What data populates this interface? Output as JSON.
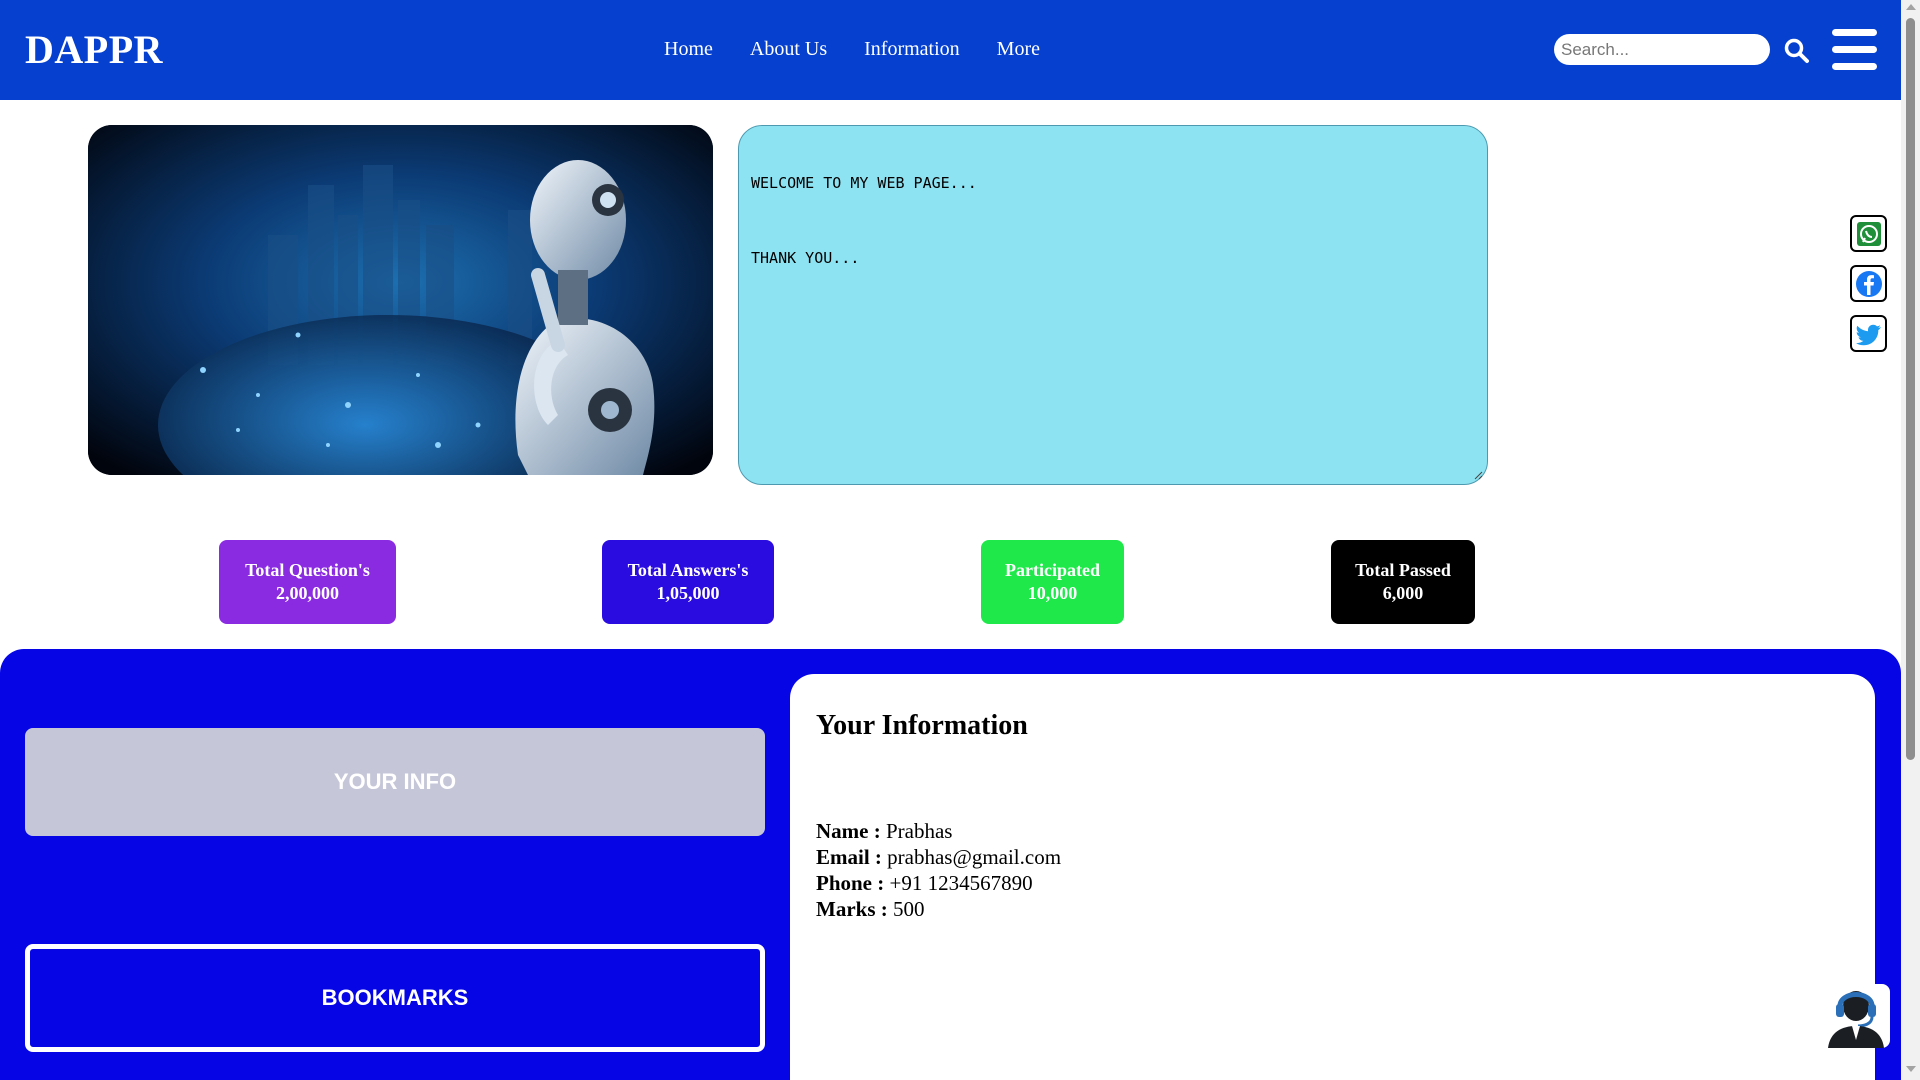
{
  "header": {
    "brand": "DAPPR",
    "nav": [
      "Home",
      "About Us",
      "Information",
      "More"
    ],
    "search_placeholder": "Search...",
    "background_color": "#0540cf"
  },
  "hero": {
    "image_description_icon": "robot-image",
    "welcome_lines": [
      "WELCOME TO MY WEB PAGE...",
      "THANK YOU..."
    ],
    "welcome_bg": "#8ee3f2"
  },
  "social": [
    "whatsapp-icon",
    "facebook-icon",
    "twitter-icon"
  ],
  "stats": [
    {
      "label": "Total Question's",
      "value": "2,00,000",
      "color": "#8a2be2"
    },
    {
      "label": "Total Answers's",
      "value": "1,05,000",
      "color": "#2a0be0"
    },
    {
      "label": "Participated",
      "value": "10,000",
      "color": "#1ee84a"
    },
    {
      "label": "Total Passed",
      "value": "6,000",
      "color": "#000000"
    }
  ],
  "lower": {
    "your_info_label": "YOUR INFO",
    "bookmarks_label": "BOOKMARKS",
    "info_title": "Your Information",
    "fields": [
      {
        "key": "Name :",
        "value": "Prabhas"
      },
      {
        "key": "Email :",
        "value": "prabhas@gmail.com"
      },
      {
        "key": "Phone :",
        "value": "+91 1234567890"
      },
      {
        "key": "Marks :",
        "value": "500"
      }
    ],
    "section_bg": "#0505e6"
  },
  "support_icon": "customer-support-icon"
}
